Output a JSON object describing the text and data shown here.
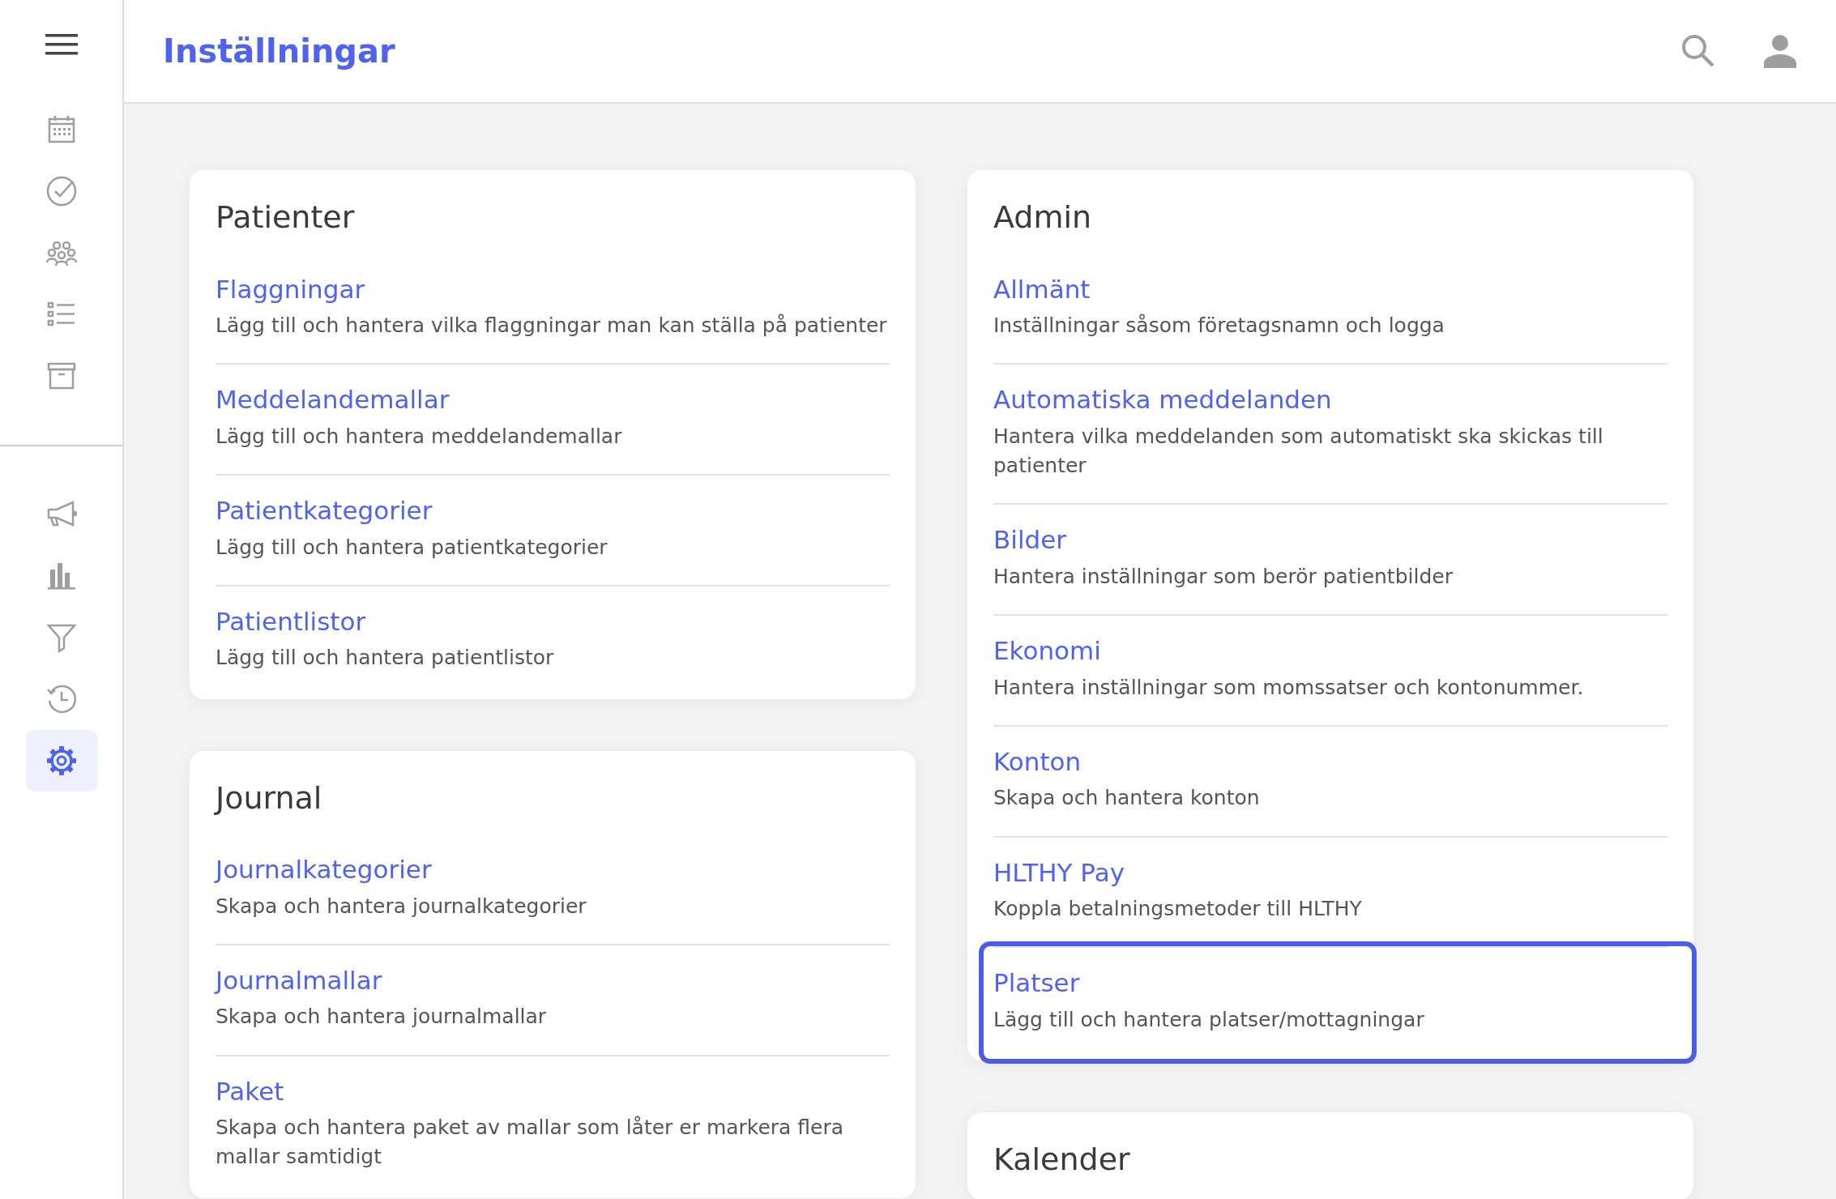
{
  "header": {
    "title": "Inställningar"
  },
  "sidebar": {
    "groups": [
      [
        {
          "selected": false
        },
        {
          "selected": false
        },
        {
          "selected": false
        },
        {
          "selected": false
        },
        {
          "selected": false
        }
      ],
      [
        {
          "selected": false
        },
        {
          "selected": false
        },
        {
          "selected": false
        },
        {
          "selected": false
        },
        {
          "selected": true
        }
      ]
    ]
  },
  "columns": [
    [
      {
        "title": "Patienter",
        "items": [
          {
            "title": "Flaggningar",
            "description": "Lägg till och hantera vilka flaggningar man kan ställa på patienter",
            "focused": false
          },
          {
            "title": "Meddelandemallar",
            "description": "Lägg till och hantera meddelandemallar",
            "focused": false
          },
          {
            "title": "Patientkategorier",
            "description": "Lägg till och hantera patientkategorier",
            "focused": false
          },
          {
            "title": "Patientlistor",
            "description": "Lägg till och hantera patientlistor",
            "focused": false
          }
        ]
      },
      {
        "title": "Journal",
        "items": [
          {
            "title": "Journalkategorier",
            "description": "Skapa och hantera journalkategorier",
            "focused": false
          },
          {
            "title": "Journalmallar",
            "description": "Skapa och hantera journalmallar",
            "focused": false
          },
          {
            "title": "Paket",
            "description": "Skapa och hantera paket av mallar som låter er markera flera mallar samtidigt",
            "focused": false
          }
        ]
      }
    ],
    [
      {
        "title": "Admin",
        "items": [
          {
            "title": "Allmänt",
            "description": "Inställningar såsom företagsnamn och logga",
            "focused": false
          },
          {
            "title": "Automatiska meddelanden",
            "description": "Hantera vilka meddelanden som automatiskt ska skickas till patienter",
            "focused": false
          },
          {
            "title": "Bilder",
            "description": "Hantera inställningar som berör patientbilder",
            "focused": false
          },
          {
            "title": "Ekonomi",
            "description": "Hantera inställningar som momssatser och kontonummer.",
            "focused": false
          },
          {
            "title": "Konton",
            "description": "Skapa och hantera konton",
            "focused": false
          },
          {
            "title": "HLTHY Pay",
            "description": "Koppla betalningsmetoder till HLTHY",
            "focused": false
          },
          {
            "title": "Platser",
            "description": "Lägg till och hantera platser/mottagningar",
            "focused": true
          }
        ]
      },
      {
        "title": "Kalender"
      }
    ]
  ]
}
